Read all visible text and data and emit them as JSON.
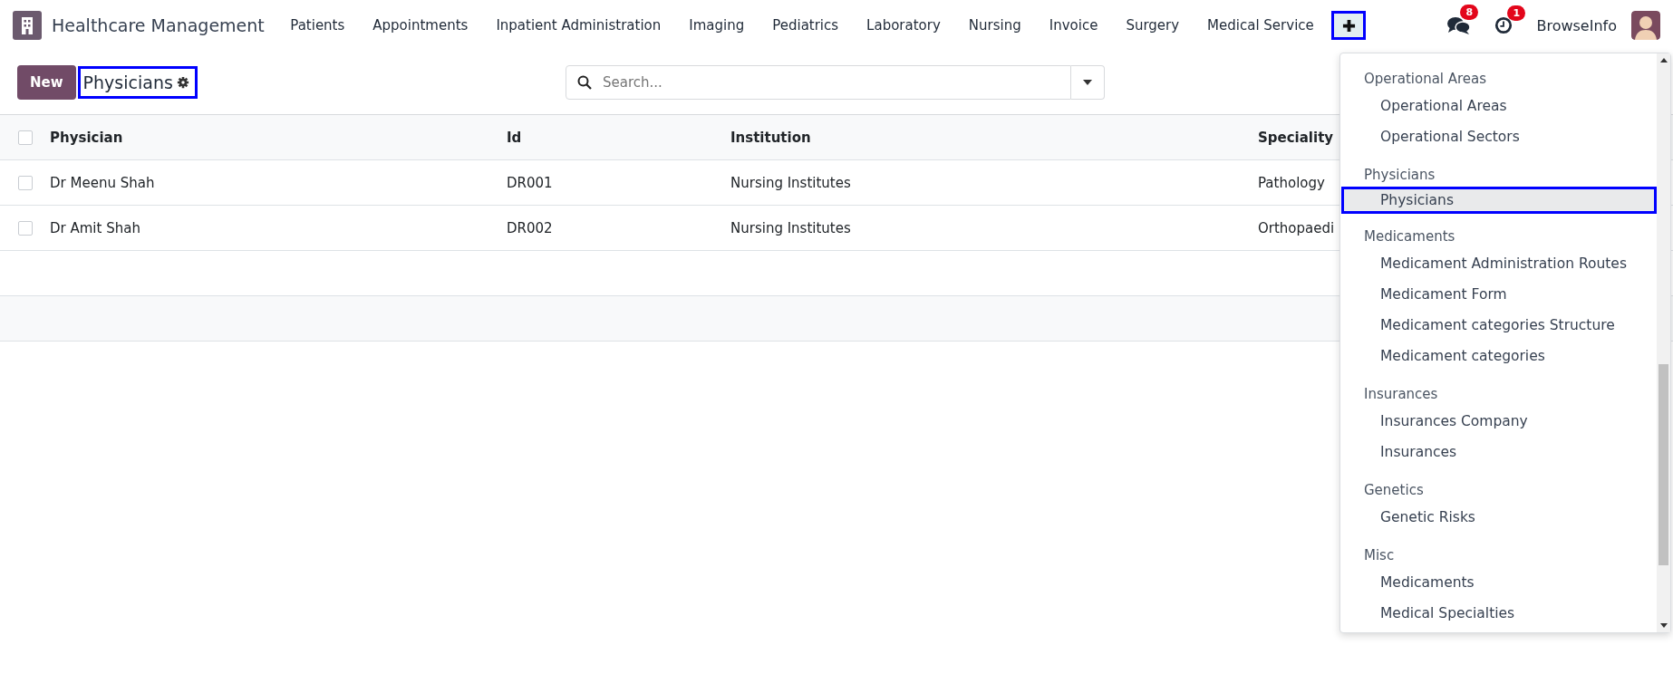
{
  "app": {
    "title": "Healthcare Management"
  },
  "menu": [
    "Patients",
    "Appointments",
    "Inpatient Administration",
    "Imaging",
    "Pediatrics",
    "Laboratory",
    "Nursing",
    "Invoice",
    "Surgery",
    "Medical Service"
  ],
  "plus_button": {
    "highlighted": true
  },
  "systray": {
    "messages_badge": "8",
    "activities_badge": "1",
    "user": "BrowseInfo"
  },
  "control_panel": {
    "new_button": "New",
    "breadcrumb": {
      "label": "Physicians",
      "highlighted": true
    },
    "search": {
      "placeholder": "Search..."
    }
  },
  "table": {
    "all_checked": false,
    "columns": [
      "Physician",
      "Id",
      "Institution",
      "Speciality"
    ],
    "rows": [
      {
        "checked": false,
        "cells": [
          "Dr Meenu Shah",
          "DR001",
          "Nursing Institutes",
          "Pathology"
        ]
      },
      {
        "checked": false,
        "cells": [
          "Dr Amit Shah",
          "DR002",
          "Nursing Institutes",
          "Orthopaedi"
        ]
      }
    ]
  },
  "dropdown": {
    "groups": [
      {
        "title": "Operational Areas",
        "items": [
          {
            "label": "Operational Areas",
            "selected": false,
            "highlighted": false
          },
          {
            "label": "Operational Sectors",
            "selected": false,
            "highlighted": false
          }
        ]
      },
      {
        "title": "Physicians",
        "items": [
          {
            "label": "Physicians",
            "selected": true,
            "highlighted": true
          }
        ]
      },
      {
        "title": "Medicaments",
        "items": [
          {
            "label": "Medicament Administration Routes",
            "selected": false,
            "highlighted": false
          },
          {
            "label": "Medicament Form",
            "selected": false,
            "highlighted": false
          },
          {
            "label": "Medicament categories Structure",
            "selected": false,
            "highlighted": false
          },
          {
            "label": "Medicament categories",
            "selected": false,
            "highlighted": false
          }
        ]
      },
      {
        "title": "Insurances",
        "items": [
          {
            "label": "Insurances Company",
            "selected": false,
            "highlighted": false
          },
          {
            "label": "Insurances",
            "selected": false,
            "highlighted": false
          }
        ]
      },
      {
        "title": "Genetics",
        "items": [
          {
            "label": "Genetic Risks",
            "selected": false,
            "highlighted": false
          }
        ]
      },
      {
        "title": "Misc",
        "items": [
          {
            "label": "Medicaments",
            "selected": false,
            "highlighted": false
          },
          {
            "label": "Medical Specialties",
            "selected": false,
            "highlighted": false
          }
        ]
      }
    ]
  }
}
